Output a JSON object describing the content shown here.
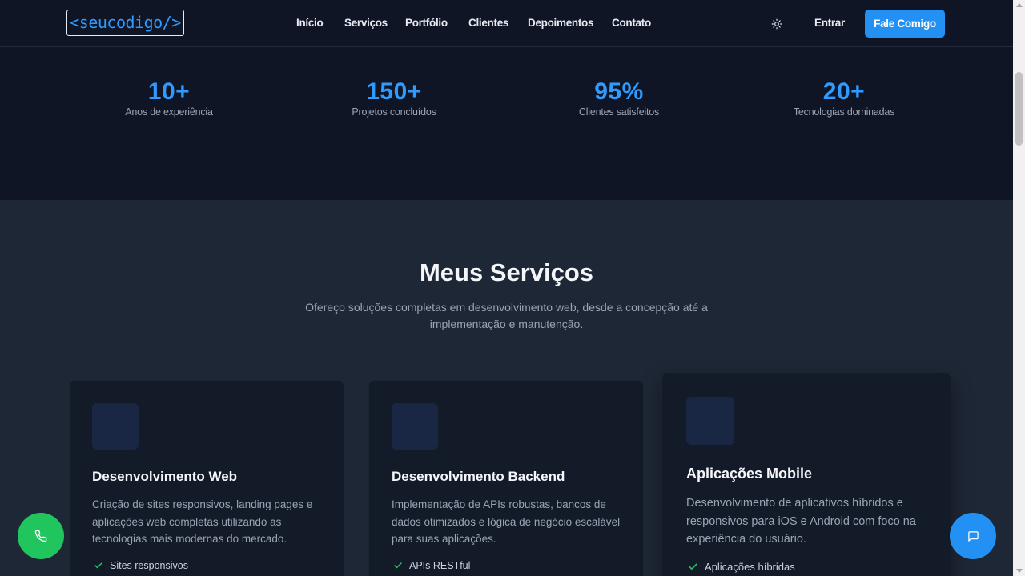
{
  "header": {
    "logo": "<seucodigo/>",
    "nav": [
      "Início",
      "Serviços",
      "Portfólio",
      "Clientes",
      "Depoimentos",
      "Contato"
    ],
    "theme_icon": "sun-icon",
    "login_label": "Entrar",
    "cta_label": "Fale Comigo"
  },
  "stats": [
    {
      "value": "10+",
      "label": "Anos de experiência"
    },
    {
      "value": "150+",
      "label": "Projetos concluídos"
    },
    {
      "value": "95%",
      "label": "Clientes satisfeitos"
    },
    {
      "value": "20+",
      "label": "Tecnologias dominadas"
    }
  ],
  "services": {
    "title": "Meus Serviços",
    "subtitle": "Ofereço soluções completas em desenvolvimento web, desde a concepção até a implementação e manutenção.",
    "cards": [
      {
        "title": "Desenvolvimento Web",
        "description": "Criação de sites responsivos, landing pages e aplicações web completas utilizando as tecnologias mais modernas do mercado.",
        "features": [
          "Sites responsivos"
        ]
      },
      {
        "title": "Desenvolvimento Backend",
        "description": "Implementação de APIs robustas, bancos de dados otimizados e lógica de negócio escalável para suas aplicações.",
        "features": [
          "APIs RESTful"
        ]
      },
      {
        "title": "Aplicações Mobile",
        "description": "Desenvolvimento de aplicativos híbridos e responsivos para iOS e Android com foco na experiência do usuário.",
        "features": [
          "Aplicações híbridas"
        ]
      }
    ]
  },
  "floating": {
    "phone_icon": "phone-icon",
    "chat_icon": "chat-icon"
  },
  "colors": {
    "accent": "#2291f3",
    "stat_value": "#2f9bff",
    "phone_button": "#21c55d",
    "dark_bg": "#0f1525",
    "section_bg": "#1e2735",
    "card_bg": "#131a28"
  }
}
